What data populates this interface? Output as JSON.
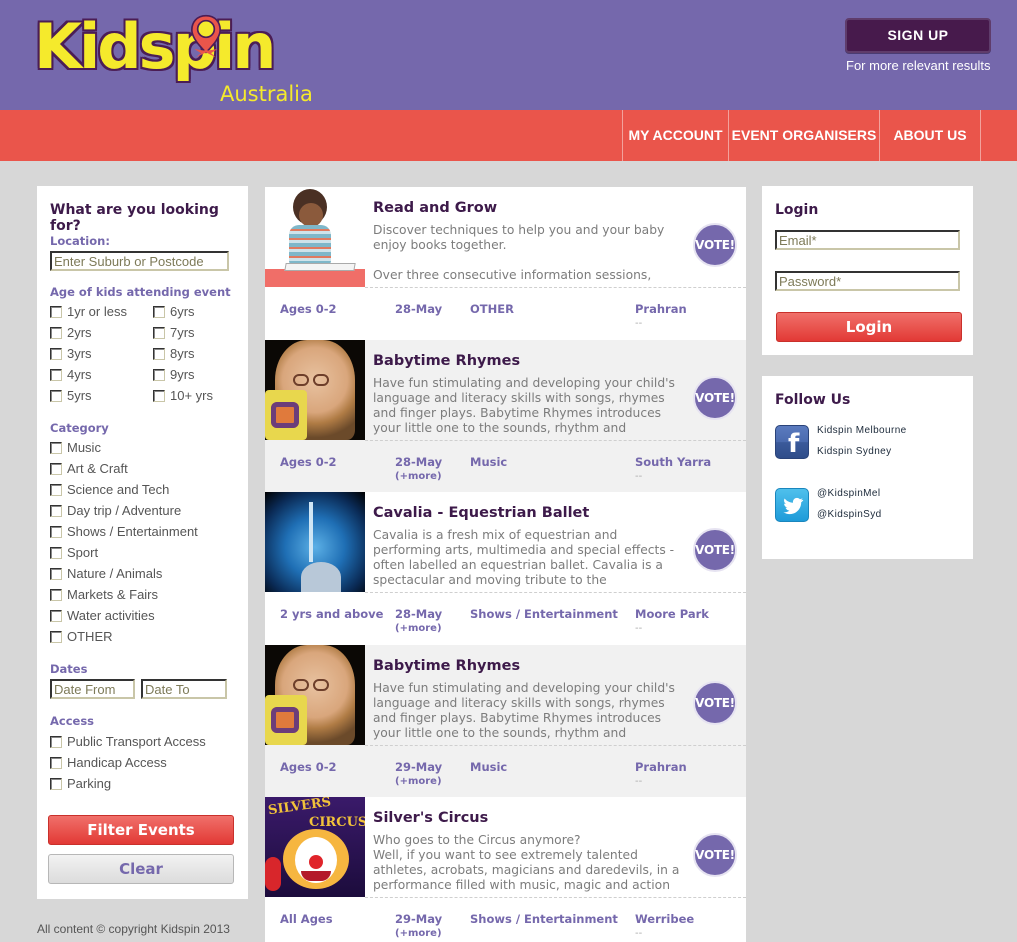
{
  "header": {
    "logo_text": "Kidspin",
    "logo_sub": "Australia",
    "signup_label": "SIGN UP",
    "signup_note": "For more relevant results"
  },
  "nav": {
    "items": [
      {
        "label": "MY ACCOUNT"
      },
      {
        "label": "EVENT ORGANISERS"
      },
      {
        "label": "ABOUT US"
      }
    ]
  },
  "filters": {
    "title": "What are you looking for?",
    "location_label": "Location:",
    "location_placeholder": "Enter Suburb or Postcode",
    "age_label": "Age of kids attending event",
    "ages": [
      "1yr or less",
      "2yrs",
      "3yrs",
      "4yrs",
      "5yrs",
      "6yrs",
      "7yrs",
      "8yrs",
      "9yrs",
      "10+ yrs"
    ],
    "category_label": "Category",
    "categories": [
      "Music",
      "Art & Craft",
      "Science and Tech",
      "Day trip / Adventure",
      "Shows / Entertainment",
      "Sport",
      "Nature / Animals",
      "Markets & Fairs",
      "Water activities",
      "OTHER"
    ],
    "dates_label": "Dates",
    "date_from_placeholder": "Date From",
    "date_to_placeholder": "Date To",
    "access_label": "Access",
    "access": [
      "Public Transport Access",
      "Handicap Access",
      "Parking"
    ],
    "filter_button": "Filter Events",
    "clear_button": "Clear"
  },
  "events": [
    {
      "title": "Read and Grow",
      "description": "Discover techniques to help you and your baby enjoy books together.\n\nOver three consecutive information sessions,",
      "vote_label": "VOTE!",
      "ages": "Ages 0-2",
      "date": "28-May",
      "more": "",
      "category": "OTHER",
      "suburb": "Prahran",
      "suburb_extra": "--",
      "image": "toddler-reading-photo"
    },
    {
      "title": "Babytime Rhymes",
      "description": "Have fun stimulating and developing your child's language and literacy skills with songs, rhymes and finger plays. Babytime Rhymes introduces your little one to the sounds, rhythm and",
      "vote_label": "VOTE!",
      "ages": "Ages 0-2",
      "date": "28-May",
      "more": "(+more)",
      "category": "Music",
      "suburb": "South Yarra",
      "suburb_extra": "--",
      "image": "child-with-glasses-photo"
    },
    {
      "title": "Cavalia - Equestrian Ballet",
      "description": "Cavalia is a fresh mix of equestrian and performing arts, multimedia and special effects - often labelled an equestrian ballet. Cavalia is a spectacular and moving tribute to the",
      "vote_label": "VOTE!",
      "ages": "2 yrs and above",
      "date": "28-May",
      "more": "(+more)",
      "category": "Shows / Entertainment",
      "suburb": "Moore Park",
      "suburb_extra": "--",
      "image": "cavalia-photo"
    },
    {
      "title": "Babytime Rhymes",
      "description": "Have fun stimulating and developing your child's language and literacy skills with songs, rhymes and finger plays. Babytime Rhymes introduces your little one to the sounds, rhythm and",
      "vote_label": "VOTE!",
      "ages": "Ages 0-2",
      "date": "29-May",
      "more": "(+more)",
      "category": "Music",
      "suburb": "Prahran",
      "suburb_extra": "--",
      "image": "child-with-glasses-photo"
    },
    {
      "title": "Silver's Circus",
      "description": "Who goes to the Circus anymore?\nWell, if you want to see extremely talented athletes, acrobats, magicians and daredevils, in a performance filled with music, magic and action",
      "vote_label": "VOTE!",
      "ages": "All Ages",
      "date": "29-May",
      "more": "(+more)",
      "category": "Shows / Entertainment",
      "suburb": "Werribee",
      "suburb_extra": "--",
      "image": "circus-clown-poster",
      "poster_text": [
        "SILVERS",
        "CIRCUS"
      ]
    }
  ],
  "login": {
    "title": "Login",
    "email_placeholder": "Email*",
    "password_placeholder": "Password*",
    "button": "Login"
  },
  "follow": {
    "title": "Follow Us",
    "facebook_icon": "f",
    "facebook_links": [
      "Kidspin Melbourne",
      "Kidspin Sydney"
    ],
    "twitter_links": [
      "@KidspinMel",
      "@KidspinSyd"
    ]
  },
  "footer": {
    "copyright": "All content © copyright Kidspin 2013"
  },
  "colors": {
    "header_bg": "#7568ac",
    "nav_bg": "#ea554b",
    "page_bg": "#d7d7d7",
    "accent_purple": "#7568ac",
    "title_dark": "#3d1a4a",
    "button_red": "#e23935",
    "logo_yellow": "#f5ea2c"
  }
}
